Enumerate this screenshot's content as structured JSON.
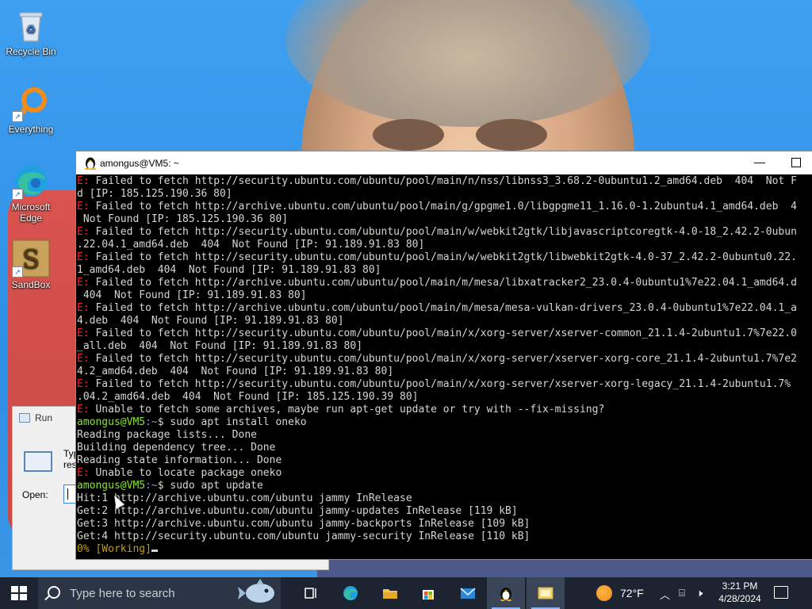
{
  "desktop": {
    "icons": [
      {
        "label": "Recycle Bin",
        "icon": "recycle-bin-icon"
      },
      {
        "label": "Everything",
        "icon": "everything-search-icon"
      },
      {
        "label": "Microsoft Edge",
        "icon": "edge-icon"
      },
      {
        "label": "SandBox",
        "icon": "sandbox-icon"
      }
    ]
  },
  "run_dialog": {
    "title": "Run",
    "desc_line1": "Typ",
    "desc_line2": "res",
    "open_label": "Open:",
    "open_value": ""
  },
  "terminal": {
    "title": "amongus@VM5: ~",
    "minimize_glyph": "—",
    "prompt_user": "amongus@VM5",
    "prompt_path": ":~",
    "prompt_symbol": "$",
    "lines": [
      {
        "prefix": "E:",
        "text": " Failed to fetch http://security.ubuntu.com/ubuntu/pool/main/n/nss/libnss3_3.68.2-0ubuntu1.2_amd64.deb  404  Not F"
      },
      {
        "prefix": "",
        "text": "d [IP: 185.125.190.36 80]"
      },
      {
        "prefix": "E:",
        "text": " Failed to fetch http://archive.ubuntu.com/ubuntu/pool/main/g/gpgme1.0/libgpgme11_1.16.0-1.2ubuntu4.1_amd64.deb  4"
      },
      {
        "prefix": "",
        "text": " Not Found [IP: 185.125.190.36 80]"
      },
      {
        "prefix": "E:",
        "text": " Failed to fetch http://security.ubuntu.com/ubuntu/pool/main/w/webkit2gtk/libjavascriptcoregtk-4.0-18_2.42.2-0ubun"
      },
      {
        "prefix": "",
        "text": ".22.04.1_amd64.deb  404  Not Found [IP: 91.189.91.83 80]"
      },
      {
        "prefix": "E:",
        "text": " Failed to fetch http://security.ubuntu.com/ubuntu/pool/main/w/webkit2gtk/libwebkit2gtk-4.0-37_2.42.2-0ubuntu0.22."
      },
      {
        "prefix": "",
        "text": "1_amd64.deb  404  Not Found [IP: 91.189.91.83 80]"
      },
      {
        "prefix": "E:",
        "text": " Failed to fetch http://archive.ubuntu.com/ubuntu/pool/main/m/mesa/libxatracker2_23.0.4-0ubuntu1%7e22.04.1_amd64.d"
      },
      {
        "prefix": "",
        "text": " 404  Not Found [IP: 91.189.91.83 80]"
      },
      {
        "prefix": "E:",
        "text": " Failed to fetch http://archive.ubuntu.com/ubuntu/pool/main/m/mesa/mesa-vulkan-drivers_23.0.4-0ubuntu1%7e22.04.1_a"
      },
      {
        "prefix": "",
        "text": "4.deb  404  Not Found [IP: 91.189.91.83 80]"
      },
      {
        "prefix": "E:",
        "text": " Failed to fetch http://security.ubuntu.com/ubuntu/pool/main/x/xorg-server/xserver-common_21.1.4-2ubuntu1.7%7e22.0"
      },
      {
        "prefix": "",
        "text": "_all.deb  404  Not Found [IP: 91.189.91.83 80]"
      },
      {
        "prefix": "E:",
        "text": " Failed to fetch http://security.ubuntu.com/ubuntu/pool/main/x/xorg-server/xserver-xorg-core_21.1.4-2ubuntu1.7%7e2"
      },
      {
        "prefix": "",
        "text": "4.2_amd64.deb  404  Not Found [IP: 91.189.91.83 80]"
      },
      {
        "prefix": "E:",
        "text": " Failed to fetch http://security.ubuntu.com/ubuntu/pool/main/x/xorg-server/xserver-xorg-legacy_21.1.4-2ubuntu1.7%"
      },
      {
        "prefix": "",
        "text": ".04.2_amd64.deb  404  Not Found [IP: 185.125.190.39 80]"
      },
      {
        "prefix": "E:",
        "text": " Unable to fetch some archives, maybe run apt-get update or try with --fix-missing?"
      }
    ],
    "cmd1": " sudo apt install oneko",
    "cmd1_output": [
      "Reading package lists... Done",
      "Building dependency tree... Done",
      "Reading state information... Done"
    ],
    "cmd1_error": " Unable to locate package oneko",
    "cmd2": " sudo apt update",
    "cmd2_output": [
      "Hit:1 http://archive.ubuntu.com/ubuntu jammy InRelease",
      "Get:2 http://archive.ubuntu.com/ubuntu jammy-updates InRelease [119 kB]",
      "Get:3 http://archive.ubuntu.com/ubuntu jammy-backports InRelease [109 kB]",
      "Get:4 http://security.ubuntu.com/ubuntu jammy-security InRelease [110 kB]"
    ],
    "progress_text": "0% [Working]"
  },
  "taskbar": {
    "search_placeholder": "Type here to search",
    "apps": [
      {
        "icon": "task-view-icon"
      },
      {
        "icon": "edge-icon"
      },
      {
        "icon": "file-explorer-icon"
      },
      {
        "icon": "microsoft-store-icon"
      },
      {
        "icon": "mail-icon"
      },
      {
        "icon": "terminal-tux-icon"
      },
      {
        "icon": "run-dialog-icon"
      }
    ],
    "weather": "72°F",
    "time": "3:21 PM",
    "date": "4/28/2024"
  },
  "colors": {
    "error": "#ef2929",
    "prompt_user": "#8ae234",
    "prompt_path": "#729fcf",
    "working": "#c4a000",
    "taskbar": "#1c2431"
  }
}
